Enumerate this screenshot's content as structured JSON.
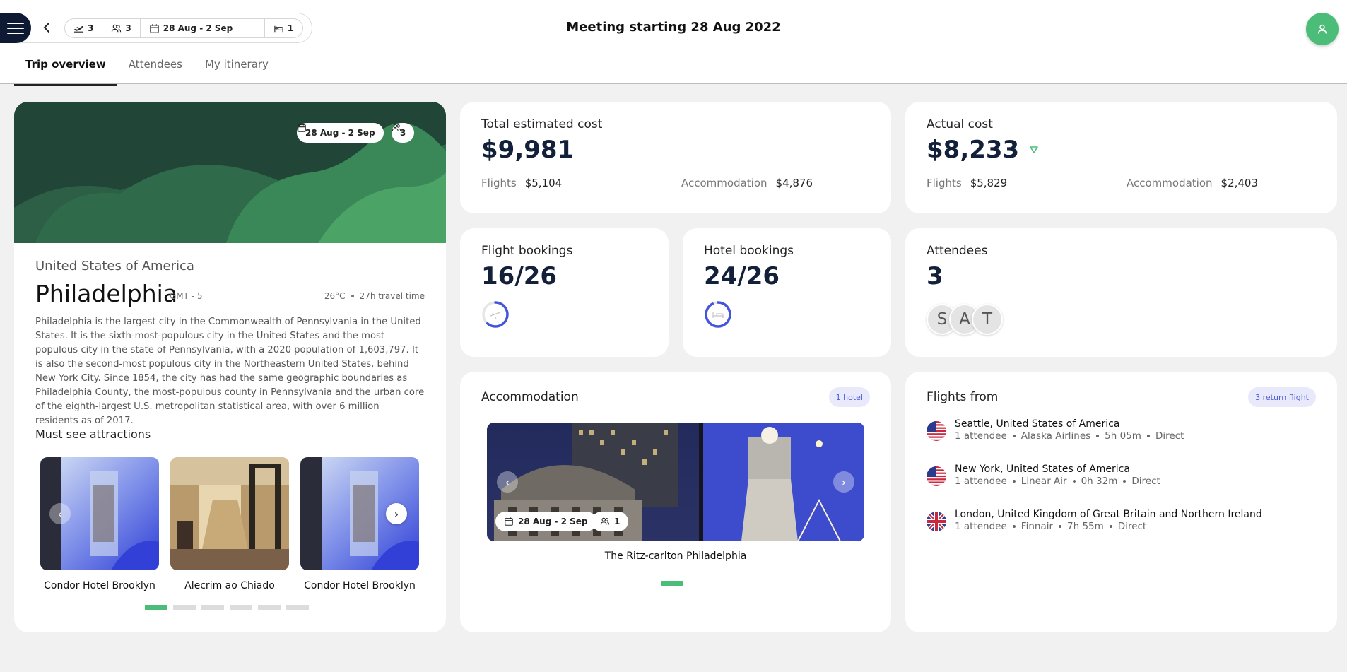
{
  "header": {
    "title": "Meeting starting 28 Aug 2022",
    "filters": {
      "flights_count": "3",
      "attendees_count": "3",
      "date_range": "28 Aug - 2 Sep",
      "hotels_count": "1"
    }
  },
  "tabs": [
    {
      "label": "Trip overview",
      "active": true
    },
    {
      "label": "Attendees",
      "active": false
    },
    {
      "label": "My itinerary",
      "active": false
    }
  ],
  "destination": {
    "date_chip": "28 Aug - 2 Sep",
    "attendees_chip": "3",
    "country": "United States of America",
    "city": "Philadelphia",
    "timezone": "GMT - 5",
    "temperature": "26°C",
    "travel_time": "27h travel time",
    "description": "Philadelphia is the largest city in the Commonwealth of Pennsylvania in the United States. It is the sixth-most-populous city in the United States and the most populous city in the state of Pennsylvania, with a 2020 population of 1,603,797. It is also the second-most populous city in the Northeastern United States, behind New York City. Since 1854, the city has had the same geographic boundaries as Philadelphia County, the most-populous county in Pennsylvania and the urban core of the eighth-largest U.S. metropolitan statistical area, with over 6 million residents as of 2017.",
    "attractions_title": "Must see attractions",
    "attractions": [
      {
        "name": "Condor Hotel Brooklyn"
      },
      {
        "name": "Alecrim ao Chiado"
      },
      {
        "name": "Condor Hotel Brooklyn"
      }
    ],
    "carousel_pages": 6,
    "carousel_active": 0
  },
  "total_cost": {
    "label": "Total estimated cost",
    "value": "$9,981",
    "flights_label": "Flights",
    "flights_value": "$5,104",
    "accommodation_label": "Accommodation",
    "accommodation_value": "$4,876"
  },
  "actual_cost": {
    "label": "Actual cost",
    "value": "$8,233",
    "flights_label": "Flights",
    "flights_value": "$5,829",
    "accommodation_label": "Accommodation",
    "accommodation_value": "$2,403"
  },
  "flight_bookings": {
    "label": "Flight bookings",
    "value": "16/26",
    "progress": 0.615
  },
  "hotel_bookings": {
    "label": "Hotel bookings",
    "value": "24/26",
    "progress": 0.923
  },
  "attendees": {
    "label": "Attendees",
    "value": "3",
    "initials": [
      "S",
      "A",
      "T"
    ]
  },
  "accommodation": {
    "label": "Accommodation",
    "badge": "1 hotel",
    "date_chip": "28 Aug - 2 Sep",
    "guests_chip": "1",
    "hotel_name": "The Ritz-carlton Philadelphia"
  },
  "flights": {
    "label": "Flights from",
    "badge": "3 return flight",
    "items": [
      {
        "flag": "us",
        "title": "Seattle, United States of America",
        "attendees": "1 attendee",
        "airline": "Alaska Airlines",
        "duration": "5h 05m",
        "type": "Direct"
      },
      {
        "flag": "us",
        "title": "New York, United States of America",
        "attendees": "1 attendee",
        "airline": "Linear Air",
        "duration": "0h 32m",
        "type": "Direct"
      },
      {
        "flag": "uk",
        "title": "London, United Kingdom of Great Britain and Northern Ireland",
        "attendees": "1 attendee",
        "airline": "Finnair",
        "duration": "7h 55m",
        "type": "Direct"
      }
    ]
  },
  "colors": {
    "accent": "#4cbd78",
    "navy": "#13203a",
    "progress_blue": "#4455dd",
    "hero_green": "#214536"
  }
}
